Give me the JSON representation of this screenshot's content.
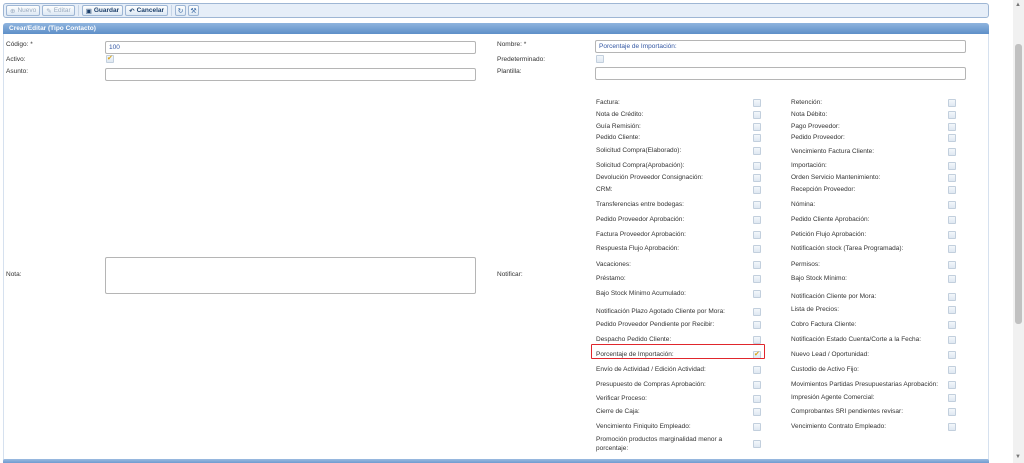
{
  "toolbar": {
    "nuevo": "Nuevo",
    "editar": "Editar",
    "guardar": "Guardar",
    "cancelar": "Cancelar"
  },
  "panel": {
    "title": "Crear/Editar (Tipo Contacto)"
  },
  "form": {
    "codigo_label": "Código: *",
    "codigo_value": "100",
    "nombre_label": "Nombre: *",
    "nombre_value": "Porcentaje de Importación:",
    "activo_label": "Activo:",
    "activo_checked": true,
    "predeterminado_label": "Predeterminado:",
    "predeterminado_checked": false,
    "asunto_label": "Asunto:",
    "asunto_value": "",
    "plantilla_label": "Plantilla:",
    "plantilla_value": "",
    "nota_label": "Nota:",
    "notificar_label": "Notificar:"
  },
  "notify_left": [
    {
      "label": "Factura:",
      "checked": false
    },
    {
      "label": "Nota de Crédito:",
      "checked": false
    },
    {
      "label": "Guía Remisión:",
      "checked": false
    },
    {
      "label": "Pedido Cliente:",
      "checked": false
    },
    {
      "label": "Solicitud Compra(Elaborado):",
      "checked": false
    },
    {
      "label": "Solicitud Compra(Aprobación):",
      "checked": false
    },
    {
      "label": "Devolución Proveedor Consignación:",
      "checked": false
    },
    {
      "label": "CRM:",
      "checked": false
    },
    {
      "label": "Transferencias entre bodegas:",
      "checked": false
    },
    {
      "label": "Pedido Proveedor Aprobación:",
      "checked": false
    },
    {
      "label": "Factura Proveedor Aprobación:",
      "checked": false
    },
    {
      "label": "Respuesta Flujo Aprobación:",
      "checked": false
    },
    {
      "label": "Vacaciones:",
      "checked": false
    },
    {
      "label": "Préstamo:",
      "checked": false
    },
    {
      "label": "Bajo Stock Mínimo Acumulado:",
      "checked": false
    },
    {
      "label": "Notificación Plazo Agotado Cliente por Mora:",
      "checked": false
    },
    {
      "label": "Pedido Proveedor Pendiente por Recibir:",
      "checked": false
    },
    {
      "label": "Despacho Pedido Cliente:",
      "checked": false
    },
    {
      "label": "Porcentaje de Importación:",
      "checked": true
    },
    {
      "label": "Envío de Actividad / Edición Actividad:",
      "checked": false
    },
    {
      "label": "Presupuesto de Compras Aprobación:",
      "checked": false
    },
    {
      "label": "Verificar Proceso:",
      "checked": false
    },
    {
      "label": "Cierre de Caja:",
      "checked": false
    },
    {
      "label": "Vencimiento Finiquito Empleado:",
      "checked": false
    },
    {
      "label": "Promoción productos marginalidad menor a porcentaje:",
      "checked": false
    }
  ],
  "notify_right": [
    {
      "label": "Retención:",
      "checked": false
    },
    {
      "label": "Nota Débito:",
      "checked": false
    },
    {
      "label": "Pago Proveedor:",
      "checked": false
    },
    {
      "label": "Pedido Proveedor:",
      "checked": false
    },
    {
      "label": "Vencimiento Factura Cliente:",
      "checked": false
    },
    {
      "label": "Importación:",
      "checked": false
    },
    {
      "label": "Orden Servicio Mantenimiento:",
      "checked": false
    },
    {
      "label": "Recepción Proveedor:",
      "checked": false
    },
    {
      "label": "Nómina:",
      "checked": false
    },
    {
      "label": "Pedido Cliente Aprobación:",
      "checked": false
    },
    {
      "label": "Petición Flujo Aprobación:",
      "checked": false
    },
    {
      "label": "Notificación stock (Tarea Programada):",
      "checked": false
    },
    {
      "label": "Permisos:",
      "checked": false
    },
    {
      "label": "Bajo Stock Mínimo:",
      "checked": false
    },
    {
      "label": "Notificación Cliente por Mora:",
      "checked": false
    },
    {
      "label": "Lista de Precios:",
      "checked": false
    },
    {
      "label": "Cobro Factura Cliente:",
      "checked": false
    },
    {
      "label": "Notificación Estado Cuenta/Corte a la Fecha:",
      "checked": false
    },
    {
      "label": "Nuevo Lead / Oportunidad:",
      "checked": false
    },
    {
      "label": "Custodio de Activo Fijo:",
      "checked": false
    },
    {
      "label": "Movimientos Partidas Presupuestarias Aprobación:",
      "checked": false
    },
    {
      "label": "Impresión Agente Comercial:",
      "checked": false
    },
    {
      "label": "Comprobantes SRI pendientes revisar:",
      "checked": false
    },
    {
      "label": "Vencimiento Contrato Empleado:",
      "checked": false
    }
  ]
}
